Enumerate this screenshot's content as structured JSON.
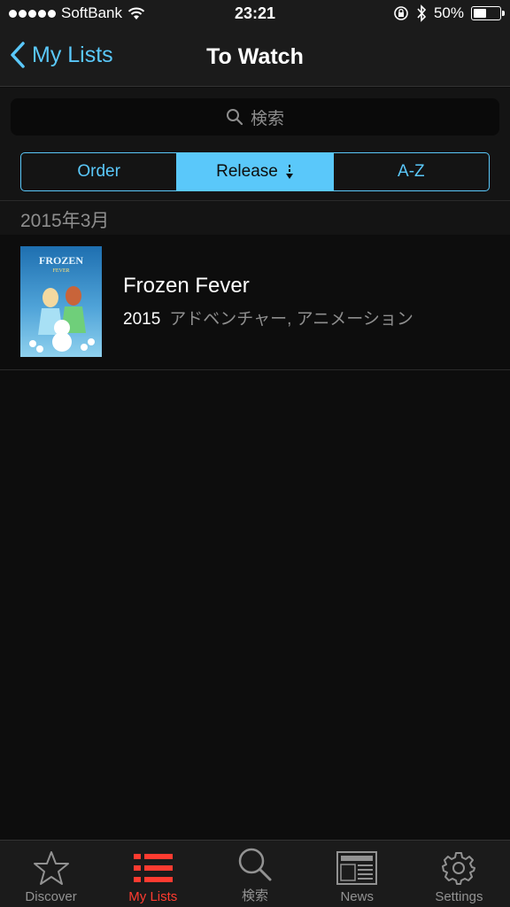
{
  "status_bar": {
    "carrier": "SoftBank",
    "time": "23:21",
    "battery": "50%",
    "battery_level": 0.5
  },
  "nav": {
    "back_label": "My Lists",
    "title": "To Watch"
  },
  "search": {
    "placeholder": "検索"
  },
  "segments": [
    {
      "label": "Order",
      "active": false
    },
    {
      "label": "Release",
      "active": true
    },
    {
      "label": "A-Z",
      "active": false
    }
  ],
  "section": {
    "header": "2015年3月"
  },
  "movies": [
    {
      "title": "Frozen Fever",
      "year": "2015",
      "genres": "アドベンチャー, アニメーション",
      "poster_text": "FROZEN",
      "poster_subtext": "FEVER"
    }
  ],
  "tabs": [
    {
      "label": "Discover",
      "icon": "star-icon",
      "active": false
    },
    {
      "label": "My Lists",
      "icon": "list-icon",
      "active": true
    },
    {
      "label": "検索",
      "icon": "search-icon",
      "active": false
    },
    {
      "label": "News",
      "icon": "newspaper-icon",
      "active": false
    },
    {
      "label": "Settings",
      "icon": "gear-icon",
      "active": false
    }
  ],
  "colors": {
    "accent": "#5ac8fa",
    "tab_active": "#ff3b30",
    "background": "#0d0d0d"
  }
}
